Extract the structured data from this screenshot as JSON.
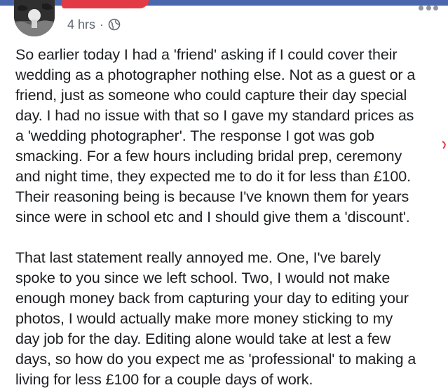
{
  "post": {
    "timestamp": "4 hrs",
    "separator": "·",
    "privacy_icon": "globe-icon",
    "menu_icon": "more-options-icon",
    "paragraph_1_lines": [
      "So earlier today I had a 'friend' asking if I could cover their",
      "wedding as a photographer nothing else. Not as a guest or a",
      "friend, just as someone who could capture their day special",
      "day. I had no issue with that so I gave my standard prices as",
      "a 'wedding photographer'. The response I got was gob",
      "smacking. For a few hours including bridal prep, ceremony",
      "and night time, they expected me to do it for less than £100.",
      "Their reasoning being is because I've known them for years",
      "since were in school etc and I should give them a 'discount'."
    ],
    "paragraph_2_lines": [
      "That last statement really annoyed me. One, I've barely",
      "spoke to you since we left school. Two, I would not make",
      "enough money back from capturing your day to editing your",
      "photos, I would actually make more money sticking to my",
      "day job for the day. Editing alone would take at lest a few",
      "days, so how do you expect me as 'professional' to making a",
      "living for less £100 for a couple days of work."
    ]
  },
  "colors": {
    "header_bar": "#4a67ad",
    "redaction": "#e33b45",
    "text": "#1c1e21",
    "meta_text": "#606770"
  }
}
